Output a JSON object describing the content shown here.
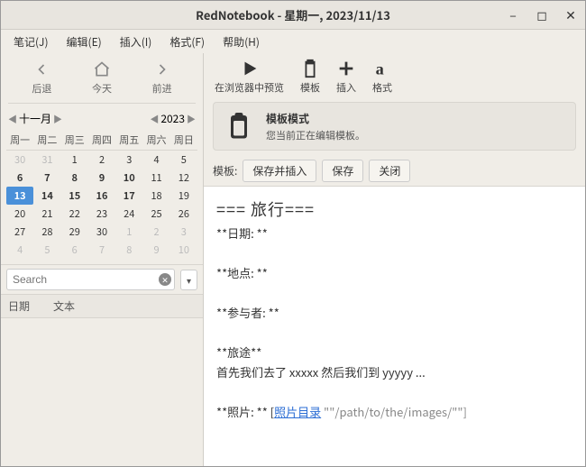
{
  "window": {
    "title": "RedNotebook - 星期一, 2023/11/13"
  },
  "menubar": {
    "items": [
      "笔记(J)",
      "编辑(E)",
      "插入(I)",
      "格式(F)",
      "帮助(H)"
    ]
  },
  "nav": {
    "back": "后退",
    "today": "今天",
    "forward": "前进"
  },
  "calendar": {
    "month": "十一月",
    "year": "2023",
    "weekdays": [
      "周一",
      "周二",
      "周三",
      "周四",
      "周五",
      "周六",
      "周日"
    ],
    "rows": [
      [
        {
          "d": "30",
          "o": true
        },
        {
          "d": "31",
          "o": true
        },
        {
          "d": "1"
        },
        {
          "d": "2"
        },
        {
          "d": "3"
        },
        {
          "d": "4"
        },
        {
          "d": "5"
        }
      ],
      [
        {
          "d": "6",
          "b": true
        },
        {
          "d": "7",
          "b": true
        },
        {
          "d": "8",
          "b": true
        },
        {
          "d": "9",
          "b": true
        },
        {
          "d": "10",
          "b": true
        },
        {
          "d": "11"
        },
        {
          "d": "12"
        }
      ],
      [
        {
          "d": "13",
          "t": true,
          "b": true
        },
        {
          "d": "14",
          "b": true
        },
        {
          "d": "15",
          "b": true
        },
        {
          "d": "16",
          "b": true
        },
        {
          "d": "17",
          "b": true
        },
        {
          "d": "18"
        },
        {
          "d": "19"
        }
      ],
      [
        {
          "d": "20"
        },
        {
          "d": "21"
        },
        {
          "d": "22"
        },
        {
          "d": "23"
        },
        {
          "d": "24"
        },
        {
          "d": "25"
        },
        {
          "d": "26"
        }
      ],
      [
        {
          "d": "27"
        },
        {
          "d": "28"
        },
        {
          "d": "29"
        },
        {
          "d": "30"
        },
        {
          "d": "1",
          "o": true
        },
        {
          "d": "2",
          "o": true
        },
        {
          "d": "3",
          "o": true
        }
      ],
      [
        {
          "d": "4",
          "o": true
        },
        {
          "d": "5",
          "o": true
        },
        {
          "d": "6",
          "o": true
        },
        {
          "d": "7",
          "o": true
        },
        {
          "d": "8",
          "o": true
        },
        {
          "d": "9",
          "o": true
        },
        {
          "d": "10",
          "o": true
        }
      ]
    ]
  },
  "search": {
    "placeholder": "Search"
  },
  "tags": {
    "col1": "日期",
    "col2": "文本"
  },
  "toolbar": {
    "preview": "在浏览器中预览",
    "template": "模板",
    "insert": "插入",
    "format": "格式"
  },
  "banner": {
    "title": "模板模式",
    "subtitle": "您当前正在编辑模板。"
  },
  "tplrow": {
    "label": "模板:",
    "save_insert": "保存并插入",
    "save": "保存",
    "close": "关闭"
  },
  "editor": {
    "heading": "=== 旅行===",
    "l1": "**日期: **",
    "l2": "**地点: **",
    "l3": "**参与者: **",
    "l4": "**旅途**",
    "l5": "首先我们去了 xxxxx 然后我们到 yyyyy ...",
    "l6a": "**照片: ** [",
    "l6link": "照片目录",
    "l6b": " \"\"/path/to/the/images/\"\"]"
  }
}
